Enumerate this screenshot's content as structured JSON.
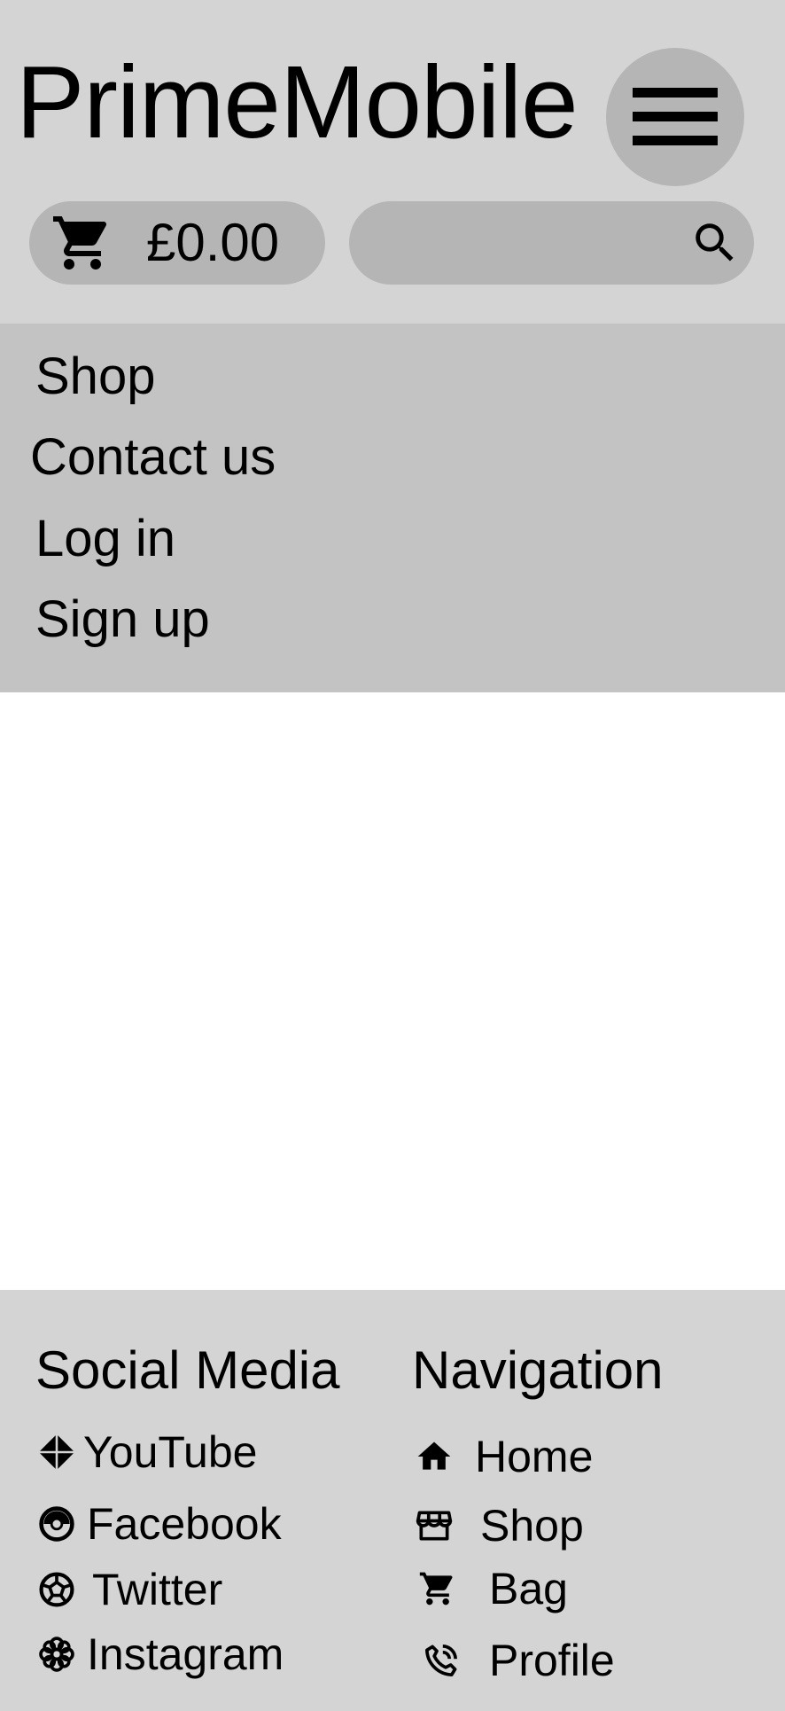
{
  "header": {
    "logo": "PrimeMobile",
    "menu_icon": "hamburger-icon",
    "cart": {
      "icon": "cart-icon",
      "total": "£0.00"
    },
    "search": {
      "icon": "search-icon",
      "value": ""
    }
  },
  "nav": {
    "items": [
      {
        "label": "Shop"
      },
      {
        "label": "Contact us"
      },
      {
        "label": "Log in"
      },
      {
        "label": "Sign up"
      }
    ]
  },
  "footer": {
    "social": {
      "heading": "Social Media",
      "links": [
        {
          "label": "YouTube",
          "icon": "youtube-icon"
        },
        {
          "label": "Facebook",
          "icon": "facebook-icon"
        },
        {
          "label": "Twitter",
          "icon": "twitter-icon"
        },
        {
          "label": "Instagram",
          "icon": "instagram-icon"
        }
      ]
    },
    "navigation": {
      "heading": "Navigation",
      "links": [
        {
          "label": "Home",
          "icon": "home-icon"
        },
        {
          "label": "Shop",
          "icon": "store-icon"
        },
        {
          "label": "Bag",
          "icon": "cart-icon"
        },
        {
          "label": "Profile",
          "icon": "phone-icon"
        }
      ]
    }
  },
  "colors": {
    "header_bg": "#d4d4d4",
    "nav_bg": "#c3c3c3",
    "pill_bg": "#b5b5b5",
    "page_bg": "#ffffff",
    "text": "#000000"
  }
}
